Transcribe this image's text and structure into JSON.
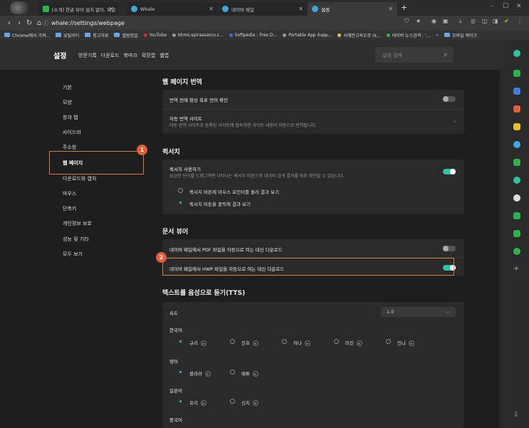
{
  "tabs": [
    {
      "title": "[소개] 한글 뷰어 설치 없이, 웨일"
    },
    {
      "title": "Whale"
    },
    {
      "title": "네이버 웨일"
    },
    {
      "title": "설정"
    }
  ],
  "address": {
    "url": "whale://settings/webpage"
  },
  "bookmarks": [
    "Chrome에서 가져...",
    "유틸리티",
    "참고자료",
    "앨범정걸",
    "YouTube",
    "bhms.spiraasarco.c...",
    "Softpedia - Free D...",
    "Portable App Supp...",
    "서해안고속도로 (k...",
    "네이버 뉴스검색 : '...",
    "모바일 북마크"
  ],
  "header": {
    "title": "설정",
    "nav": [
      "방문기록",
      "다운로드",
      "북마크",
      "확장앱",
      "웹앱"
    ],
    "search_placeholder": "설정 검색"
  },
  "sidebar": {
    "items": [
      "기본",
      "모양",
      "창과 탭",
      "사이드바",
      "주소창",
      "웹 페이지",
      "다운로드와 캡처",
      "마우스",
      "단축키",
      "개인정보 보호",
      "성능 및 기타",
      "모두 보기"
    ]
  },
  "badges": [
    "1",
    "2"
  ],
  "sections": {
    "translate": {
      "title": "웹 페이지 번역",
      "ask_label": "번역 전에 항상 목표 언어 확인",
      "ask_on": false,
      "auto_label": "자동 번역 사이트",
      "auto_sub": "자동 번역 사이트로 등록된 사이트에 접속하면 사이트 내용이 자동으로 번역됩니다."
    },
    "quick_search": {
      "title": "퀵서치",
      "use_label": "퀵서치 사용하기",
      "use_sub": "궁금한 단어를 드래그하면 나타나는 퀵서치 버튼으로 네이버 검색 결과를 바로 확인할 수 있습니다.",
      "use_on": true,
      "option1": "퀵서치 버튼에 마우스 포인터를 올려 결과 보기",
      "option2": "퀵서치 버튼을 클릭해 결과 보기",
      "selected": 2
    },
    "docs": {
      "title": "문서 뷰어",
      "pdf_label": "네이버 웨일에서 PDF 파일을 자동으로 여는 대신 다운로드",
      "pdf_on": false,
      "hwp_label": "네이버 웨일에서 HWP 파일을 자동으로 여는 대신 다운로드",
      "hwp_on": true
    },
    "tts": {
      "title": "텍스트를 음성으로 듣기(TTS)",
      "speed_label": "속도",
      "speed_value": "1.0",
      "korean_label": "한국어",
      "korean_voices": [
        "규리",
        "진호",
        "하나",
        "미진",
        "인나"
      ],
      "english_label": "영어",
      "english_voices": [
        "클라라",
        "매튜"
      ],
      "japanese_label": "일본어",
      "japanese_voices": [
        "유리",
        "신지"
      ],
      "chinese_label": "중국어"
    }
  },
  "colors": {
    "accent": "#2fc2a5",
    "highlight": "#d87a3b",
    "badge": "#e05e3a"
  }
}
